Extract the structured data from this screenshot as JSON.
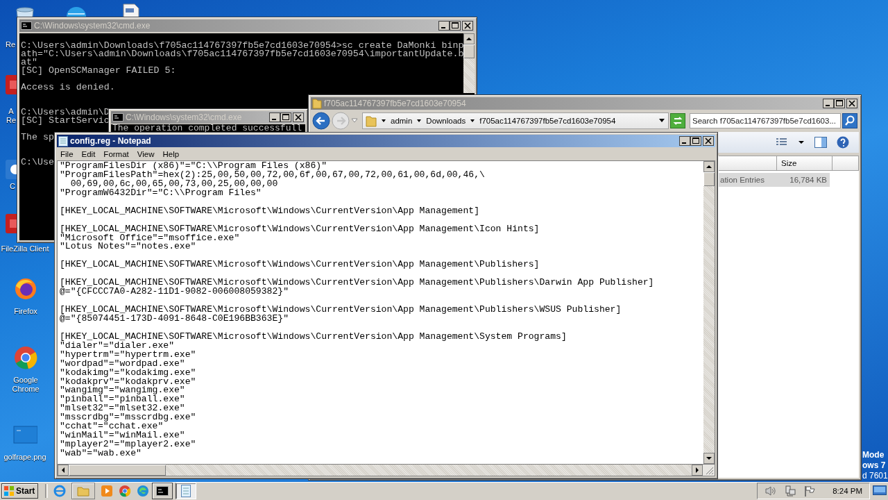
{
  "desktop_icons": [
    {
      "kind": "bin",
      "label_lines": [
        "Re"
      ]
    },
    {
      "kind": "globe"
    },
    {
      "kind": "document"
    },
    {
      "kind": "red-app",
      "label_lines": [
        "A",
        "Re"
      ]
    },
    {
      "kind": "blue-app",
      "label_lines": [
        "C"
      ]
    },
    {
      "kind": "red-app",
      "label_lines": [
        "FileZilla Client"
      ]
    },
    {
      "kind": "firefox",
      "label_lines": [
        "Firefox"
      ]
    },
    {
      "kind": "chrome",
      "label_lines": [
        "Google",
        "Chrome"
      ]
    },
    {
      "kind": "image",
      "label_lines": [
        "golfrape.png"
      ]
    }
  ],
  "desktop_text": [
    "Mode",
    "ows 7",
    "d 7601"
  ],
  "cmd_main": {
    "title": "C:\\Windows\\system32\\cmd.exe",
    "blocks": [
      {
        "lines": [
          "C:\\Users\\admin\\Downloads\\f705ac114767397fb5e7cd1603e70954>sc create DaMonki binp",
          "ath=\"C:\\Users\\admin\\Downloads\\f705ac114767397fb5e7cd1603e70954\\importantUpdate.b",
          "at\"",
          "[SC] OpenSCManager FAILED 5:"
        ]
      },
      {
        "lines": [
          "Access is denied."
        ]
      },
      {
        "lines": [
          "C:\\Users\\admin\\D",
          "[SC] StartServic"
        ]
      },
      {
        "lines": [
          "The sp"
        ]
      },
      {
        "lines": [
          "C:\\Use"
        ]
      }
    ]
  },
  "cmd_second": {
    "title": "C:\\Windows\\system32\\cmd.exe",
    "lines": [
      "The operation completed successfull"
    ]
  },
  "explorer": {
    "title": "f705ac114767397fb5e7cd1603e70954",
    "breadcrumb": [
      "admin",
      "Downloads",
      "f705ac114767397fb5e7cd1603e70954"
    ],
    "search": {
      "placeholder": "Search f705ac114767397fb5e7cd1603..."
    },
    "columns": [
      {
        "label": "Size"
      }
    ],
    "rows": [
      {
        "cells": [
          "ation Entries",
          "16,784 KB"
        ],
        "selected": true
      }
    ]
  },
  "notepad": {
    "title": "config.reg - Notepad",
    "menu": [
      "File",
      "Edit",
      "Format",
      "View",
      "Help"
    ],
    "blocks": [
      [
        "\"ProgramFilesDir (x86)\"=\"C:\\\\Program Files (x86)\"",
        "\"ProgramFilesPath\"=hex(2):25,00,50,00,72,00,6f,00,67,00,72,00,61,00,6d,00,46,\\",
        "  00,69,00,6c,00,65,00,73,00,25,00,00,00",
        "\"ProgramW6432Dir\"=\"C:\\\\Program Files\""
      ],
      [
        "[HKEY_LOCAL_MACHINE\\SOFTWARE\\Microsoft\\Windows\\CurrentVersion\\App Management]"
      ],
      [
        "[HKEY_LOCAL_MACHINE\\SOFTWARE\\Microsoft\\Windows\\CurrentVersion\\App Management\\Icon Hints]",
        "\"Microsoft Office\"=\"msoffice.exe\"",
        "\"Lotus Notes\"=\"notes.exe\""
      ],
      [
        "[HKEY_LOCAL_MACHINE\\SOFTWARE\\Microsoft\\Windows\\CurrentVersion\\App Management\\Publishers]"
      ],
      [
        "[HKEY_LOCAL_MACHINE\\SOFTWARE\\Microsoft\\Windows\\CurrentVersion\\App Management\\Publishers\\Darwin App Publisher]",
        "@=\"{CFCCC7A0-A282-11D1-9082-006008059382}\""
      ],
      [
        "[HKEY_LOCAL_MACHINE\\SOFTWARE\\Microsoft\\Windows\\CurrentVersion\\App Management\\Publishers\\WSUS Publisher]",
        "@=\"{85074451-173D-4091-8648-C0E196BB363E}\""
      ],
      [
        "[HKEY_LOCAL_MACHINE\\SOFTWARE\\Microsoft\\Windows\\CurrentVersion\\App Management\\System Programs]",
        "\"dialer\"=\"dialer.exe\"",
        "\"hypertrm\"=\"hypertrm.exe\"",
        "\"wordpad\"=\"wordpad.exe\"",
        "\"kodakimg\"=\"kodakimg.exe\"",
        "\"kodakprv\"=\"kodakprv.exe\"",
        "\"wangimg\"=\"wangimg.exe\"",
        "\"pinball\"=\"pinball.exe\"",
        "\"mlset32\"=\"mlset32.exe\"",
        "\"msscrdbg\"=\"msscrdbg.exe\"",
        "\"cchat\"=\"cchat.exe\"",
        "\"winMail\"=\"winMail.exe\"",
        "\"mplayer2\"=\"mplayer2.exe\"",
        "\"wab\"=\"wab.exe\""
      ]
    ]
  },
  "taskbar": {
    "start": "Start",
    "quick_launch": [
      {
        "kind": "ie"
      },
      {
        "kind": "folder"
      },
      {
        "kind": "media"
      },
      {
        "kind": "chrome"
      },
      {
        "kind": "edge"
      }
    ],
    "tasks": [
      {
        "kind": "cmd",
        "selected": false
      },
      {
        "kind": "notepad",
        "selected": true
      }
    ],
    "tray": [
      {
        "kind": "speaker"
      },
      {
        "kind": "network"
      },
      {
        "kind": "flag"
      }
    ],
    "clock": "8:24 PM"
  }
}
